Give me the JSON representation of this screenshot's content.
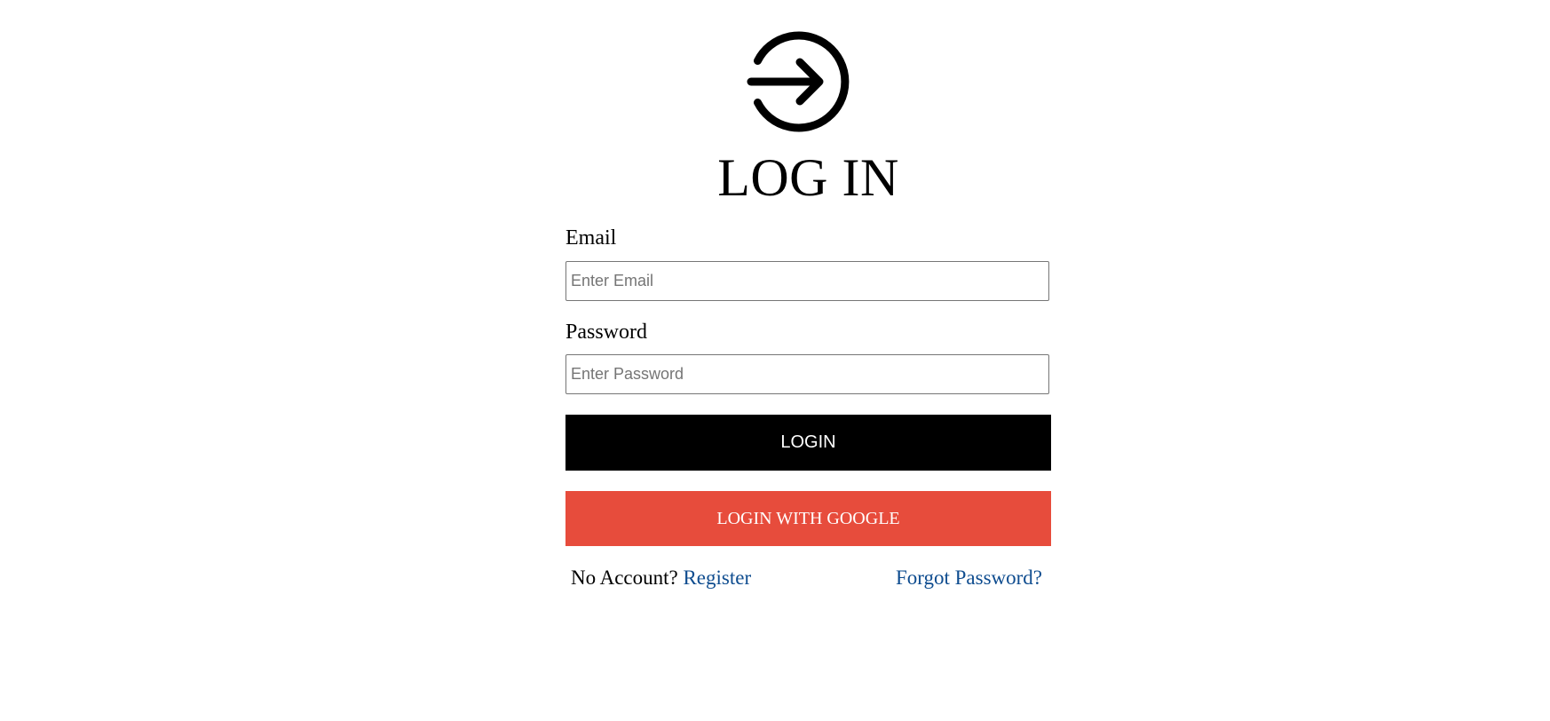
{
  "header": {
    "icon": "login-arrow-circle-icon",
    "title": "LOG IN"
  },
  "form": {
    "email": {
      "label": "Email",
      "placeholder": "Enter Email",
      "value": ""
    },
    "password": {
      "label": "Password",
      "placeholder": "Enter Password",
      "value": ""
    },
    "login_button": "LOGIN",
    "google_button": "LOGIN WITH GOOGLE"
  },
  "footer": {
    "no_account_text": "No Account?",
    "register_link": "Register",
    "forgot_link": "Forgot Password?"
  },
  "colors": {
    "background": "#ffffff",
    "login_button": "#000000",
    "google_button": "#e74c3c",
    "link": "#0e4c8f",
    "input_border": "#767676"
  }
}
